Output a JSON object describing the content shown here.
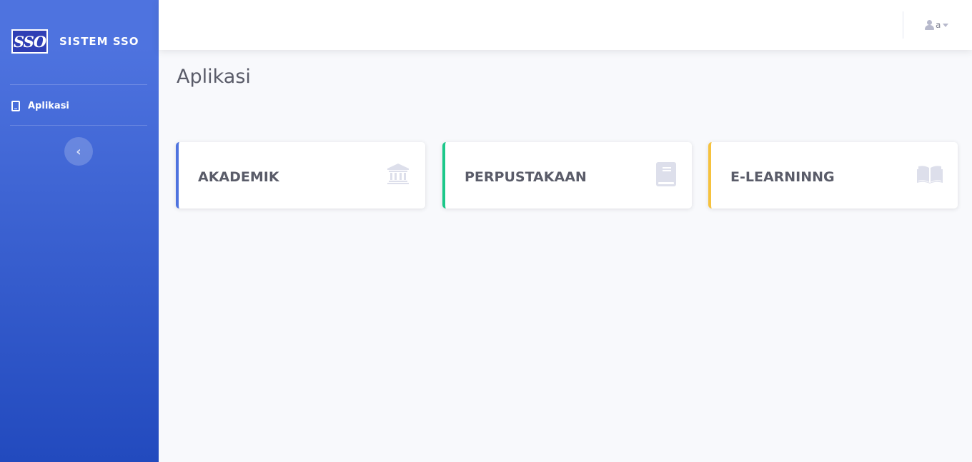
{
  "sidebar": {
    "brand_logo": "SSO",
    "brand_text": "SISTEM SSO",
    "items": [
      {
        "label": "Aplikasi",
        "icon": "tablet-icon"
      }
    ],
    "toggle_symbol": "‹"
  },
  "topbar": {
    "user_name": "a"
  },
  "main": {
    "title": "Aplikasi",
    "cards": [
      {
        "label": "AKADEMIK",
        "icon": "university-icon",
        "accent": "#4e73df"
      },
      {
        "label": "PERPUSTAKAAN",
        "icon": "book-icon",
        "accent": "#1cc88a"
      },
      {
        "label": "E-LEARNINNG",
        "icon": "open-book-icon",
        "accent": "#f6c23e"
      }
    ]
  },
  "colors": {
    "sidebar_top": "#4e73df",
    "sidebar_bottom": "#224abe",
    "page_bg": "#f8f9fc",
    "text": "#5a5c69",
    "icon_muted": "#dddfeb"
  }
}
